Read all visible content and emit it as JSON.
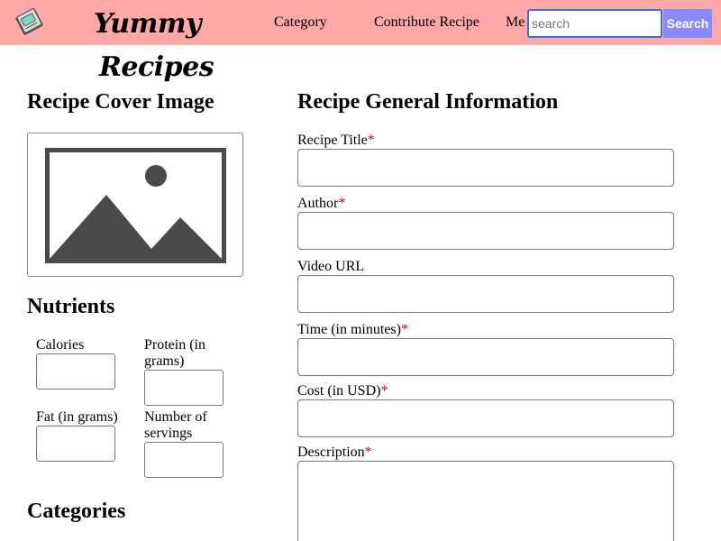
{
  "header": {
    "brand_line1": "Yummy",
    "brand_line2": "Recipes",
    "nav": {
      "category": "Category",
      "contribute": "Contribute Recipe",
      "me": "Me"
    },
    "search": {
      "placeholder": "search",
      "button_label": "Search"
    },
    "colors": {
      "navbar_bg": "#ffa8a8",
      "search_button_bg": "#8a8aff"
    }
  },
  "cover": {
    "heading": "Recipe Cover Image",
    "placeholder_icon": "image-placeholder-icon"
  },
  "nutrients": {
    "heading": "Nutrients",
    "fields": {
      "calories": "Calories",
      "protein": "Protein (in grams)",
      "fat": "Fat (in grams)",
      "servings": "Number of servings"
    }
  },
  "categories": {
    "heading": "Categories"
  },
  "general": {
    "heading": "Recipe General Information",
    "required_marker": "*",
    "fields": {
      "title": "Recipe Title",
      "author": "Author",
      "video": "Video URL",
      "time": "Time (in minutes)",
      "cost": "Cost (in USD)",
      "description": "Description"
    }
  }
}
